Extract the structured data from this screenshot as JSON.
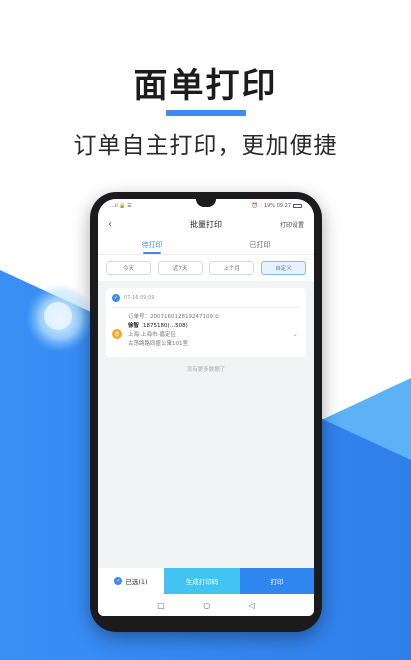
{
  "promo": {
    "headline": "面单打印",
    "subline": "订单自主打印，更加便捷",
    "accent_color": "#3d8bf2"
  },
  "statusbar": {
    "left": "…ıl 🔒 ☰",
    "right": "⏰ ◦ 19% 09:27"
  },
  "navbar": {
    "back_icon": "‹",
    "title": "批量打印",
    "right_label": "打印设置"
  },
  "tabs": [
    {
      "label": "待打印",
      "active": true
    },
    {
      "label": "已打印",
      "active": false
    }
  ],
  "filters": [
    {
      "label": "今天",
      "active": false
    },
    {
      "label": "近7天",
      "active": false
    },
    {
      "label": "上个月",
      "active": false
    },
    {
      "label": "自定义",
      "active": true
    }
  ],
  "order": {
    "date": "07-16 09:09",
    "order_no": "订单号：20071601281924710​9",
    "recv_badge": "收",
    "recipient_name": "徐智",
    "recipient_phone": "1875180(…508)",
    "address_1": "上海-上海市-嘉定区",
    "address_2": "古荡路路同盛公寓101室"
  },
  "end_text": "没有更多数据了",
  "bottom_bar": {
    "selected_label": "已选(1)",
    "generate_label": "生成打印码",
    "print_label": "打印"
  },
  "sysnav": {
    "recent_icon": "□",
    "home_icon": "○",
    "back_icon": "◁"
  }
}
